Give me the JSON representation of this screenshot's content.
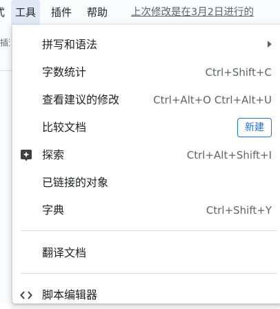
{
  "menubar": {
    "items": [
      {
        "label": "式"
      },
      {
        "label": "工具"
      },
      {
        "label": "插件"
      },
      {
        "label": "帮助"
      }
    ],
    "last_edit": "上次修改是在3月2日进行的"
  },
  "left_fragment": "插道",
  "menu": {
    "items": [
      {
        "label": "拼写和语法",
        "has_submenu": true
      },
      {
        "label": "字数统计",
        "shortcut": "Ctrl+Shift+C"
      },
      {
        "label": "查看建议的修改",
        "shortcut": "Ctrl+Alt+O Ctrl+Alt+U"
      },
      {
        "label": "比较文档",
        "badge": "新建"
      },
      {
        "label": "探索",
        "shortcut": "Ctrl+Alt+Shift+I",
        "icon": "explore-icon"
      },
      {
        "label": "已链接的对象"
      },
      {
        "label": "字典",
        "shortcut": "Ctrl+Shift+Y"
      },
      {
        "label": "翻译文档"
      },
      {
        "label": "脚本编辑器",
        "icon": "code-icon"
      }
    ]
  },
  "colors": {
    "accent": "#1a73e8",
    "menubar_bg": "#f9fbfd",
    "active_bg": "#e1e9f7",
    "text": "#202124",
    "secondary_text": "#5f6368"
  }
}
